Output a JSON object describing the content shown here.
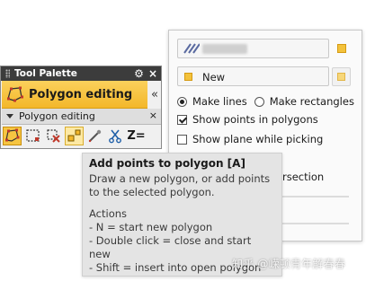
{
  "options_panel": {
    "field2_text": "New",
    "radio_make_lines": "Make lines",
    "radio_make_rectangles": "Make rectangles",
    "check_show_points": "Show points in polygons",
    "check_show_plane": "Show plane while picking",
    "partial_label": "rsection",
    "make_lines_selected": true,
    "show_points_checked": true,
    "show_plane_checked": false
  },
  "palette": {
    "title": "Tool Palette",
    "header": "Polygon editing",
    "section": "Polygon editing",
    "collapse_glyph": "«",
    "close_glyph": "×",
    "gear_glyph": "⚙",
    "tools": [
      "edit-polygon",
      "select-region",
      "delete-points",
      "add-points",
      "pick-point",
      "cut",
      "set-z"
    ],
    "z_label": "Z="
  },
  "tooltip": {
    "title": "Add points to polygon [A]",
    "line1": "Draw a new polygon, or add points",
    "line2": "to the selected polygon.",
    "actions_head": "Actions",
    "action1": "- N = start new polygon",
    "action2": "- Double click = close and start new",
    "action3": "- Shift = insert into open polygon"
  },
  "watermark": "知乎 @嵘顿青年解春春",
  "colors": {
    "accent": "#f3b72a",
    "title_bar": "#3c3c3c",
    "tooltip_bg": "#e4e4e4"
  }
}
